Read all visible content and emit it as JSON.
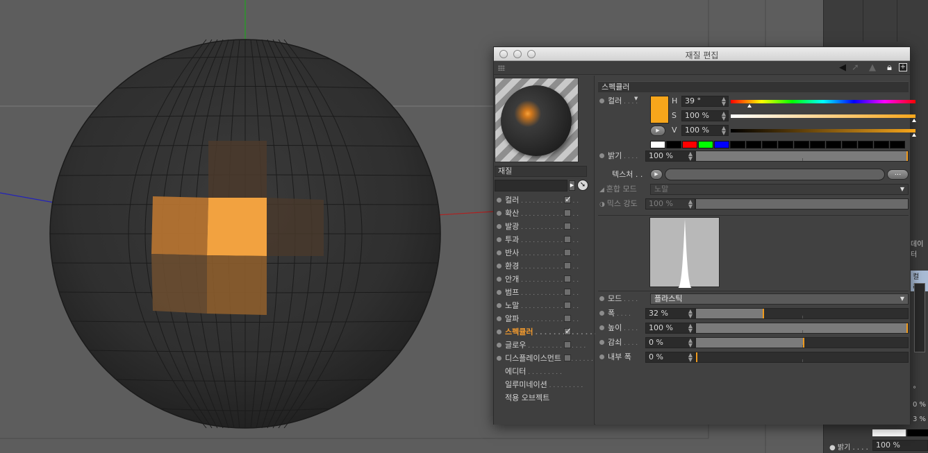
{
  "window": {
    "title": "재질 편집"
  },
  "material": {
    "header": "재질"
  },
  "channels": [
    {
      "label": "컬러",
      "checked": true
    },
    {
      "label": "확산",
      "checked": false
    },
    {
      "label": "발광",
      "checked": false
    },
    {
      "label": "투과",
      "checked": false
    },
    {
      "label": "반사",
      "checked": false
    },
    {
      "label": "환경",
      "checked": false
    },
    {
      "label": "안개",
      "checked": false
    },
    {
      "label": "범프",
      "checked": false
    },
    {
      "label": "노말",
      "checked": false
    },
    {
      "label": "알파",
      "checked": false
    },
    {
      "label": "스펙큘러",
      "checked": true,
      "active": true
    },
    {
      "label": "글로우",
      "checked": false
    },
    {
      "label": "디스플레이스먼트",
      "checked": false
    }
  ],
  "extras": [
    {
      "label": "에디터"
    },
    {
      "label": "일루미네이션"
    },
    {
      "label": "적용 오브젝트"
    }
  ],
  "specular": {
    "section_title": "스펙큘러",
    "color_label": "컬러",
    "color_hex": "#f7a61b",
    "h_label": "H",
    "h_value": "39 °",
    "s_label": "S",
    "s_value": "100 %",
    "v_label": "V",
    "v_value": "100 %",
    "swatches": [
      "#ffffff",
      "#000000",
      "#ff0000",
      "#00ff00",
      "#0000ff",
      "#000000",
      "#000000",
      "#000000",
      "#000000",
      "#000000",
      "#000000",
      "#000000",
      "#000000",
      "#000000",
      "#000000",
      "#000000"
    ],
    "brightness_label": "밝기",
    "brightness_value": "100 %",
    "brightness": 1.0,
    "texture_label": "텍스처",
    "texture_more": "...",
    "blend_label": "혼합 모드",
    "blend_value": "노말",
    "mix_label": "믹스 강도",
    "mix_value": "100 %",
    "mode_label": "모드",
    "mode_value": "플라스틱",
    "width_label": "폭",
    "width_value": "32 %",
    "width": 0.32,
    "height_label": "높이",
    "height_value": "100 %",
    "height": 1.0,
    "falloff_label": "감쇠",
    "falloff_value": "0 %",
    "falloff": 0.51,
    "inner_label": "내부 폭",
    "inner_value": "0 %",
    "inner": 0.0
  },
  "side_panel": {
    "tab_label": "데이터",
    "item_label": "컬러",
    "row1": "°",
    "row2": "0 %",
    "row3": "3 %",
    "brightness_label": "밝기",
    "brightness_value": "100 %"
  },
  "colors": {
    "accent": "#f09a1b",
    "active_channel": "#f29a2e"
  }
}
